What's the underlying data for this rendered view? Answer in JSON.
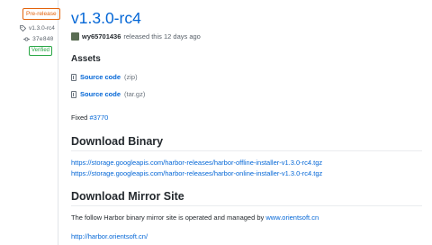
{
  "sidebar": {
    "prerelease_label": "Pre-release",
    "tag": "v1.3.0-rc4",
    "commit": "37e840",
    "verified_label": "Verified"
  },
  "release": {
    "title": "v1.3.0-rc4",
    "author": "wy65701436",
    "released_text": "released this 12 days ago"
  },
  "assets": {
    "heading": "Assets",
    "items": [
      {
        "label": "Source code",
        "ext": "(zip)"
      },
      {
        "label": "Source code",
        "ext": "(tar.gz)"
      }
    ]
  },
  "fixed": {
    "prefix": "Fixed",
    "issue": "#3770"
  },
  "download_binary": {
    "heading": "Download Binary",
    "links": [
      "https://storage.googleapis.com/harbor-releases/harbor-offline-installer-v1.3.0-rc4.tgz",
      "https://storage.googleapis.com/harbor-releases/harbor-online-installer-v1.3.0-rc4.tgz"
    ]
  },
  "mirror": {
    "heading": "Download Mirror Site",
    "text": "The follow Harbor binary mirror site is operated and managed by",
    "site_link": "www.orientsoft.cn",
    "url": "http://harbor.orientsoft.cn/"
  },
  "colors": {
    "link": "#0366d6",
    "prerelease": "#e36209",
    "verified": "#28a745"
  }
}
